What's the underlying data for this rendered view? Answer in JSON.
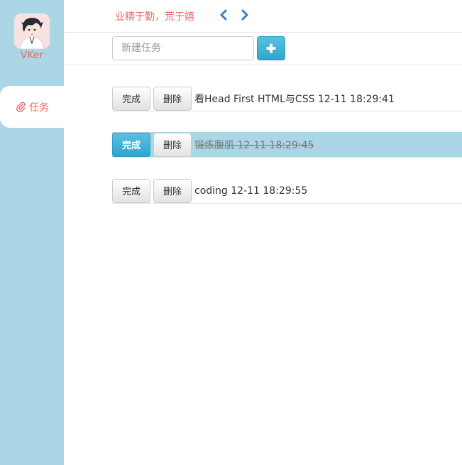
{
  "sidebar": {
    "username": "VKer",
    "nav_items": [
      {
        "label": "任务",
        "icon": "paperclip-icon",
        "active": true
      }
    ]
  },
  "header": {
    "motto": "业精于勤，荒于嬉",
    "prev_icon": "chevron-left-icon",
    "next_icon": "chevron-right-icon"
  },
  "add_task": {
    "placeholder": "新建任务",
    "value": "",
    "add_icon": "plus-icon"
  },
  "tasks": [
    {
      "text": "看Head First HTML与CSS 12-11 18:29:41",
      "done": false,
      "complete_label": "完成",
      "delete_label": "删除"
    },
    {
      "text": "锻炼腹肌 12-11 18:29:45",
      "done": true,
      "complete_label": "完成",
      "delete_label": "删除"
    },
    {
      "text": "coding 12-11 18:29:55",
      "done": false,
      "complete_label": "完成",
      "delete_label": "删除"
    }
  ],
  "colors": {
    "sidebar_bg": "#abd6e5",
    "accent_text": "#e26a6a",
    "primary_button": "#2fa6cf",
    "done_row_bg": "#abd6e5"
  }
}
